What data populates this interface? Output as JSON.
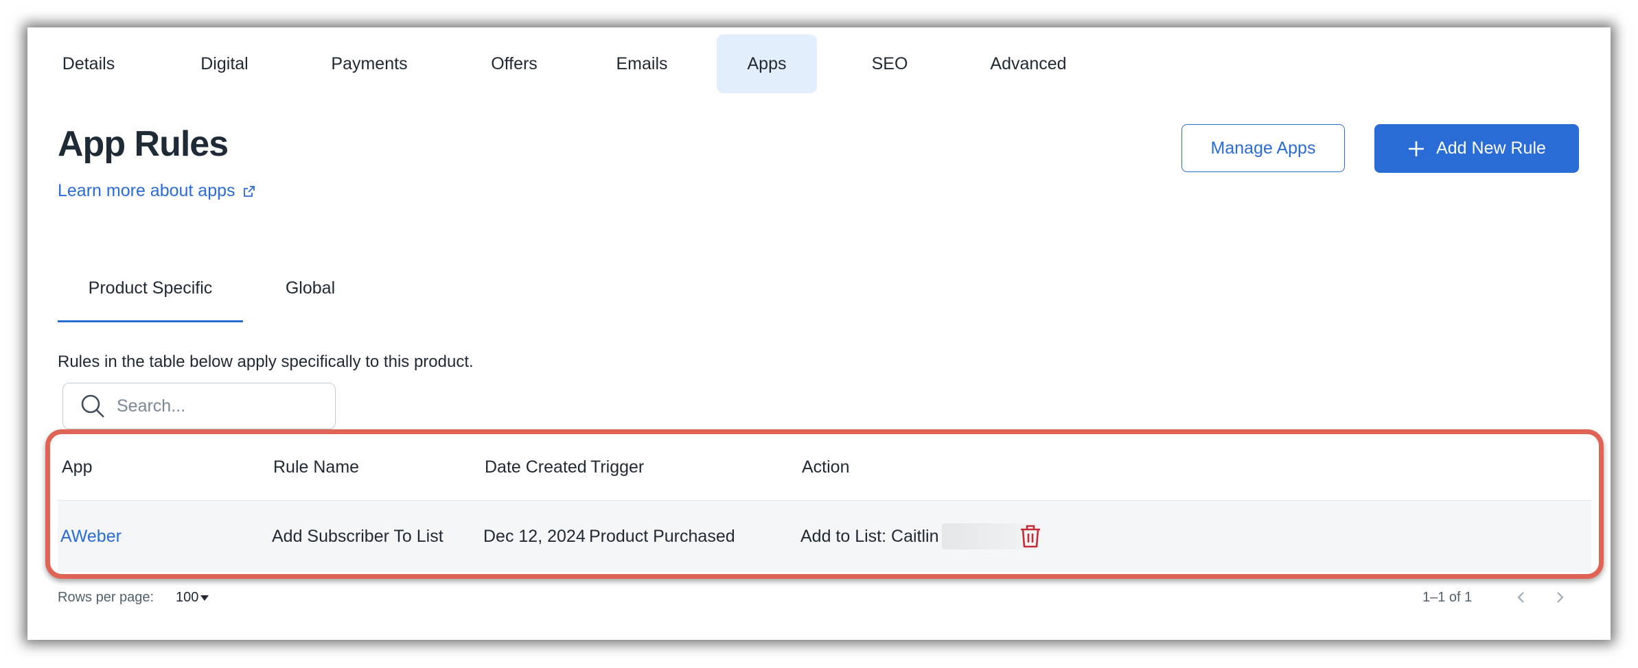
{
  "top_tabs": [
    {
      "label": "Details"
    },
    {
      "label": "Digital"
    },
    {
      "label": "Payments"
    },
    {
      "label": "Offers"
    },
    {
      "label": "Emails"
    },
    {
      "label": "Apps",
      "active": true
    },
    {
      "label": "SEO"
    },
    {
      "label": "Advanced"
    }
  ],
  "page": {
    "title": "App Rules",
    "learn_more": "Learn more about apps",
    "manage_apps": "Manage Apps",
    "add_new_rule": "Add New Rule"
  },
  "sub_tabs": [
    {
      "label": "Product Specific",
      "active": true
    },
    {
      "label": "Global"
    }
  ],
  "description": "Rules in the table below apply specifically to this product.",
  "search": {
    "placeholder": "Search..."
  },
  "table": {
    "headers": [
      "App",
      "Rule Name",
      "Date Created",
      "Trigger",
      "Action"
    ],
    "rows": [
      {
        "app": "AWeber",
        "rule_name": "Add Subscriber To List",
        "date_created": "Dec 12, 2024",
        "trigger": "Product Purchased",
        "action": "Add to List: Caitlin"
      }
    ]
  },
  "pagination": {
    "rows_per_page_label": "Rows per page:",
    "rows_per_page_value": "100",
    "range": "1–1 of 1"
  },
  "colors": {
    "accent": "#2a6cd6",
    "active_tab_bg": "#e2eefb",
    "highlight_border": "#df6455",
    "delete_icon": "#c62b38"
  }
}
